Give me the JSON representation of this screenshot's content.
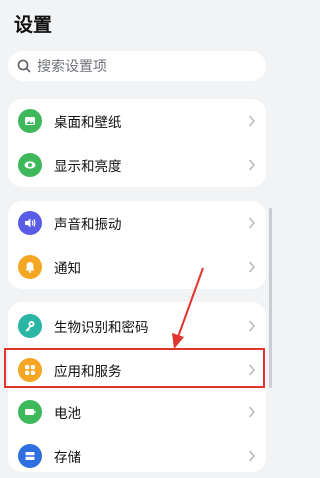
{
  "header": {
    "title": "设置"
  },
  "search": {
    "placeholder": "搜索设置项"
  },
  "groups": [
    {
      "items": [
        {
          "label": "桌面和壁纸",
          "icon": "wallpaper-icon",
          "color": "#3fb85c"
        },
        {
          "label": "显示和亮度",
          "icon": "eye-icon",
          "color": "#3fb85c"
        }
      ]
    },
    {
      "items": [
        {
          "label": "声音和振动",
          "icon": "speaker-icon",
          "color": "#5a5ce6"
        },
        {
          "label": "通知",
          "icon": "bell-icon",
          "color": "#f5a623"
        }
      ]
    },
    {
      "items": [
        {
          "label": "生物识别和密码",
          "icon": "key-icon",
          "color": "#2bb5a4"
        },
        {
          "label": "应用和服务",
          "icon": "apps-grid-icon",
          "color": "#f5a623"
        },
        {
          "label": "电池",
          "icon": "battery-icon",
          "color": "#3fb85c"
        },
        {
          "label": "存储",
          "icon": "storage-icon",
          "color": "#2f6fe0"
        }
      ]
    }
  ],
  "annotation": {
    "color": "#e0352f"
  }
}
